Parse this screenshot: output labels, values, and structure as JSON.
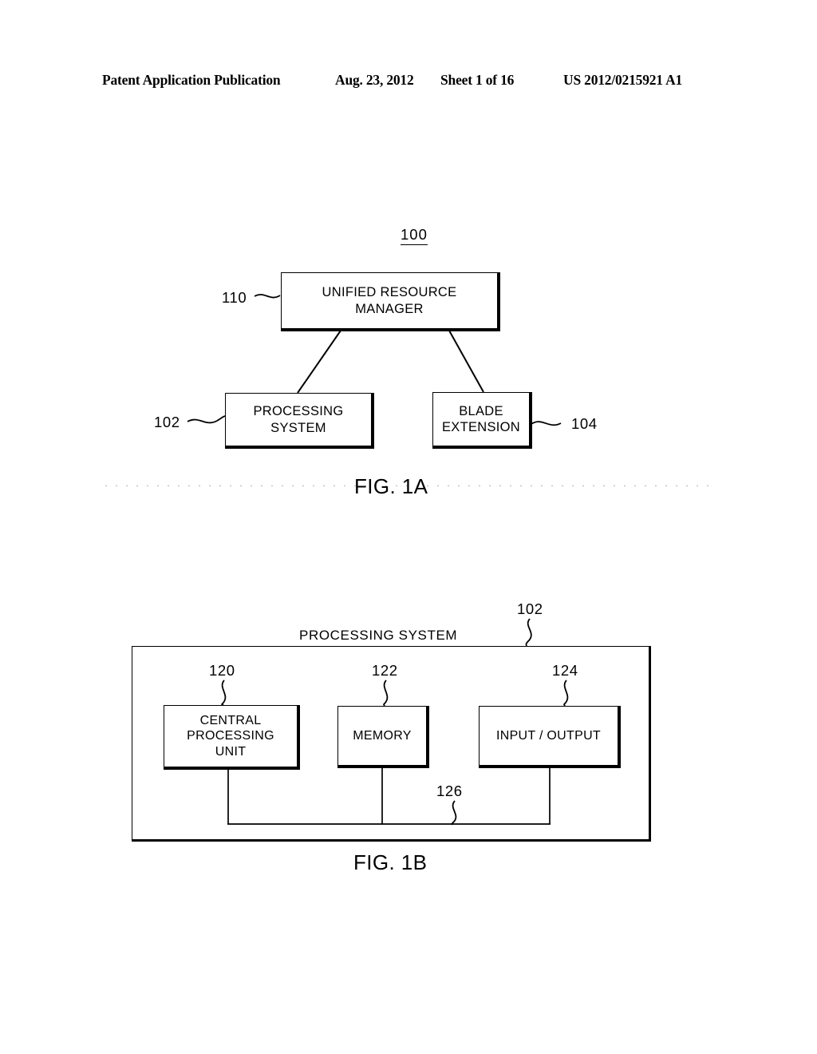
{
  "header": {
    "publication": "Patent Application Publication",
    "date": "Aug. 23, 2012",
    "sheet": "Sheet 1 of 16",
    "number": "US 2012/0215921 A1"
  },
  "figures": [
    {
      "caption": "FIG. 1A",
      "system_ref": "100",
      "nodes": [
        {
          "ref": "110",
          "label_line1": "UNIFIED RESOURCE",
          "label_line2": "MANAGER"
        },
        {
          "ref": "102",
          "label_line1": "PROCESSING",
          "label_line2": "SYSTEM"
        },
        {
          "ref": "104",
          "label_line1": "BLADE",
          "label_line2": "EXTENSION"
        }
      ]
    },
    {
      "caption": "FIG. 1B",
      "title": "PROCESSING SYSTEM",
      "system_ref": "102",
      "nodes": [
        {
          "ref": "120",
          "label_line1": "CENTRAL",
          "label_line2": "PROCESSING",
          "label_line3": "UNIT"
        },
        {
          "ref": "122",
          "label_line1": "MEMORY"
        },
        {
          "ref": "124",
          "label_line1": "INPUT / OUTPUT"
        }
      ],
      "bus_ref": "126"
    }
  ],
  "colors": {
    "ink": "#000000",
    "paper": "#ffffff"
  }
}
